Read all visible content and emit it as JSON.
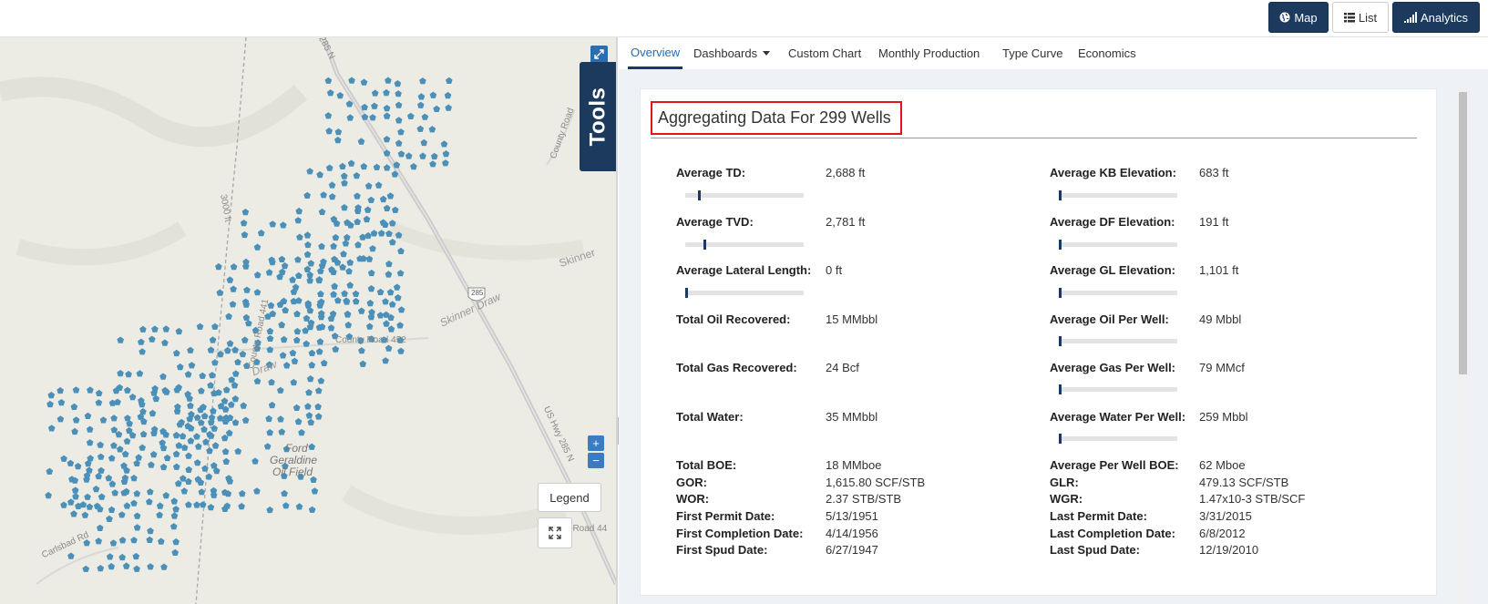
{
  "topbar": {
    "map_label": "Map",
    "list_label": "List",
    "analytics_label": "Analytics"
  },
  "map": {
    "tools_label": "Tools",
    "legend_label": "Legend",
    "zoom_in": "+",
    "zoom_out": "−",
    "labels": {
      "hwy_285_n": "285 N",
      "county_road_top": "County Road",
      "contour_3000": "3000 ft",
      "skinner": "Skinner",
      "skinner_draw": "Skinner Draw",
      "county_road_452": "County Road 452",
      "county_road_441": "County Road 441",
      "us_hwy_285_n": "US Hwy 285 N",
      "ford_geraldine": "Ford",
      "geraldine": "Geraldine",
      "oil_field": "Oil Field",
      "carlsbad_rd": "Carlsbad Rd",
      "county_road_44_bottom": "County Road 44",
      "shield_285": "285",
      "draw_label": "Draw"
    },
    "well_color": "#4a90b8"
  },
  "tabs": [
    {
      "label": "Overview"
    },
    {
      "label": "Dashboards"
    },
    {
      "label": "Custom Chart"
    },
    {
      "label": "Monthly Production"
    },
    {
      "label": "Type Curve"
    },
    {
      "label": "Economics"
    }
  ],
  "overview": {
    "heading": "Aggregating Data For 299 Wells",
    "left": [
      {
        "label": "Average TD:",
        "value": "2,688 ft",
        "bar_fraction": 0.11
      },
      {
        "label": "Average TVD:",
        "value": "2,781 ft",
        "bar_fraction": 0.16
      },
      {
        "label": "Average Lateral Length:",
        "value": "0 ft",
        "bar_fraction": 0.0
      },
      {
        "label": "Total Oil Recovered:",
        "value": "15 MMbbl"
      },
      {
        "label": "Total Gas Recovered:",
        "value": "24 Bcf"
      },
      {
        "label": "Total Water:",
        "value": "35 MMbbl"
      }
    ],
    "right": [
      {
        "label": "Average KB Elevation:",
        "value": "683 ft",
        "bar_fraction": 0.0
      },
      {
        "label": "Average DF Elevation:",
        "value": "191 ft",
        "bar_fraction": 0.0
      },
      {
        "label": "Average GL Elevation:",
        "value": "1,101 ft",
        "bar_fraction": 0.0
      },
      {
        "label": "Average Oil Per Well:",
        "value": "49 Mbbl",
        "bar_fraction": 0.0
      },
      {
        "label": "Average Gas Per Well:",
        "value": "79 MMcf",
        "bar_fraction": 0.0
      },
      {
        "label": "Average Water Per Well:",
        "value": "259 Mbbl",
        "bar_fraction": 0.0
      }
    ],
    "left_bottom": [
      {
        "label": "Total BOE:",
        "value": "18 MMboe"
      },
      {
        "label": "GOR:",
        "value": "1,615.80 SCF/STB"
      },
      {
        "label": "WOR:",
        "value": "2.37 STB/STB"
      },
      {
        "label": "First Permit Date:",
        "value": "5/13/1951"
      },
      {
        "label": "First Completion Date:",
        "value": "4/14/1956"
      },
      {
        "label": "First Spud Date:",
        "value": "6/27/1947"
      }
    ],
    "right_bottom": [
      {
        "label": "Average Per Well BOE:",
        "value": "62 Mboe"
      },
      {
        "label": "GLR:",
        "value": "479.13 SCF/STB"
      },
      {
        "label": "WGR:",
        "value": "1.47x10-3 STB/SCF"
      },
      {
        "label": "Last Permit Date:",
        "value": "3/31/2015"
      },
      {
        "label": "Last Completion Date:",
        "value": "6/8/2012"
      },
      {
        "label": "Last Spud Date:",
        "value": "12/19/2010"
      }
    ]
  }
}
